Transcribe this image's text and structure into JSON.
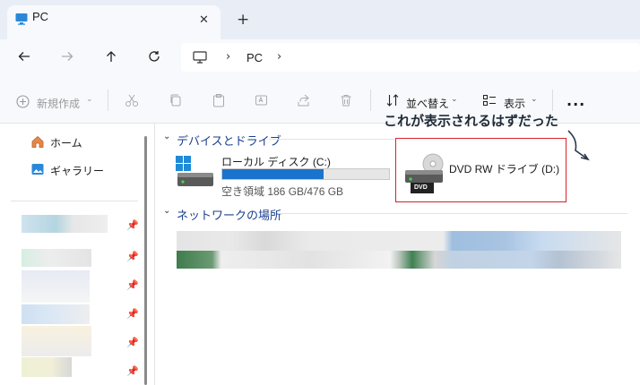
{
  "tab": {
    "title": "PC",
    "close_icon": "close-icon",
    "new_tab": "+"
  },
  "address": {
    "path_root": "PC"
  },
  "toolbar": {
    "new_label": "新規作成",
    "sort_label": "並べ替え",
    "view_label": "表示",
    "more_label": "..."
  },
  "sidebar": {
    "home_label": "ホーム",
    "gallery_label": "ギャラリー"
  },
  "devices": {
    "heading": "デバイスとドライブ",
    "local_disk": {
      "name": "ローカル ディスク (C:)",
      "usage": "空き領域 186 GB/476 GB",
      "used_fraction": 0.61
    },
    "dvd": {
      "name": "DVD RW ドライブ (D:)",
      "badge": "DVD"
    }
  },
  "network": {
    "heading": "ネットワークの場所"
  },
  "annotation": {
    "text": "これが表示されるはずだった"
  },
  "colors": {
    "accent": "#1a73cc",
    "highlight": "#d2232a"
  }
}
